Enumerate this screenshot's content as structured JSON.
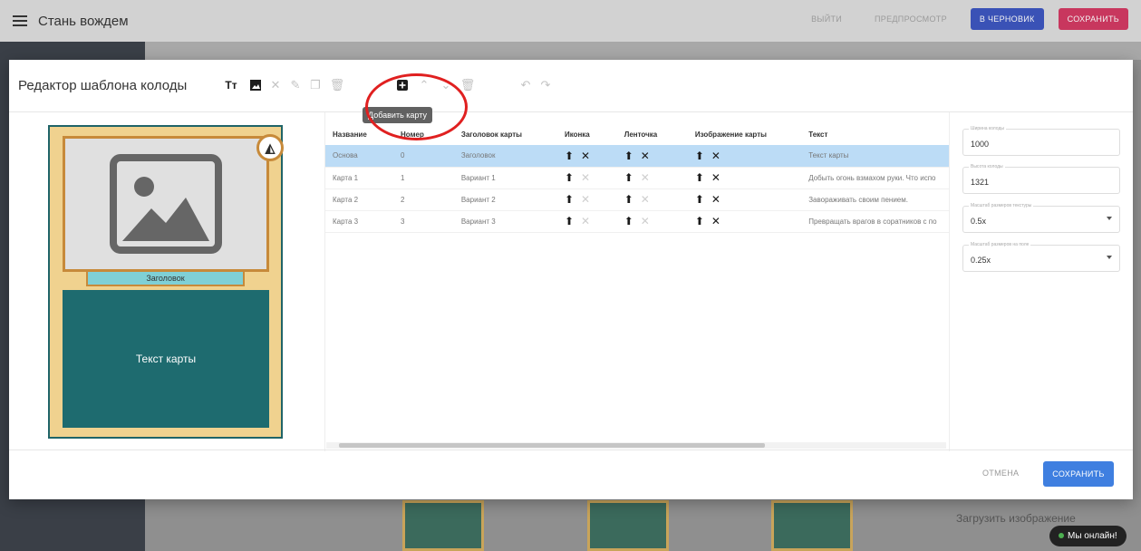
{
  "app": {
    "title": "Стань вождем",
    "actions": {
      "logout": "ВЫЙТИ",
      "preview": "ПРЕДПРОСМОТР",
      "draft": "В ЧЕРНОВИК",
      "save": "СОХРАНИТЬ"
    },
    "upload_text": "Загрузить изображение",
    "online_badge": "Мы онлайн!"
  },
  "modal": {
    "title": "Редактор шаблона колоды",
    "tooltip": "Добавить карту",
    "cancel": "ОТМЕНА",
    "save": "СОХРАНИТЬ"
  },
  "preview": {
    "ribbon": "Заголовок",
    "text": "Текст карты"
  },
  "table": {
    "headers": [
      "Название",
      "Номер",
      "Заголовок карты",
      "Иконка",
      "Ленточка",
      "Изображение карты",
      "Текст"
    ],
    "rows": [
      {
        "name": "Основа",
        "number": "0",
        "heading": "Заголовок",
        "text": "Текст карты",
        "selected": true
      },
      {
        "name": "Карта 1",
        "number": "1",
        "heading": "Вариант 1",
        "text": "Добыть огонь взмахом руки. Что испо",
        "selected": false
      },
      {
        "name": "Карта 2",
        "number": "2",
        "heading": "Вариант 2",
        "text": "Завораживать своим пением.",
        "selected": false
      },
      {
        "name": "Карта 3",
        "number": "3",
        "heading": "Вариант 3",
        "text": "Превращать врагов в соратников с по",
        "selected": false
      }
    ]
  },
  "fields": {
    "width": {
      "label": "Ширина колоды",
      "value": "1000"
    },
    "height": {
      "label": "Высота колоды",
      "value": "1321"
    },
    "texture_scale": {
      "label": "Масштаб размеров текстуры",
      "value": "0.5x"
    },
    "field_scale": {
      "label": "Масштаб размеров на поле",
      "value": "0.25x"
    }
  }
}
